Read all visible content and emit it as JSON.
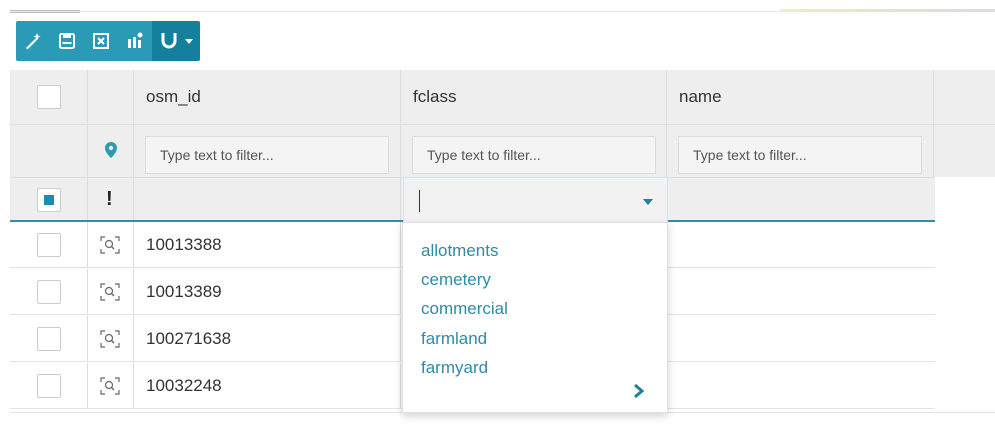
{
  "toolbar": {
    "buttons": [
      "edit-geometry-icon",
      "save-icon",
      "cancel-icon",
      "map-icon"
    ],
    "magnet": "magnet-icon",
    "dropdown": "chevron-down-icon"
  },
  "grid": {
    "columns": [
      "osm_id",
      "fclass",
      "name"
    ],
    "filter_placeholder": "Type text to filter...",
    "edit_marker": "!",
    "rows": [
      {
        "osm_id": "10013388"
      },
      {
        "osm_id": "10013389"
      },
      {
        "osm_id": "100271638"
      },
      {
        "osm_id": "10032248"
      }
    ]
  },
  "fclass_dropdown": {
    "value": "",
    "options": [
      "allotments",
      "cemetery",
      "commercial",
      "farmland",
      "farmyard"
    ],
    "more_icon": "chevron-right-icon"
  },
  "colors": {
    "accent": "#2b9bb5",
    "accent_dark": "#15809c",
    "link": "#2f8aa7"
  }
}
